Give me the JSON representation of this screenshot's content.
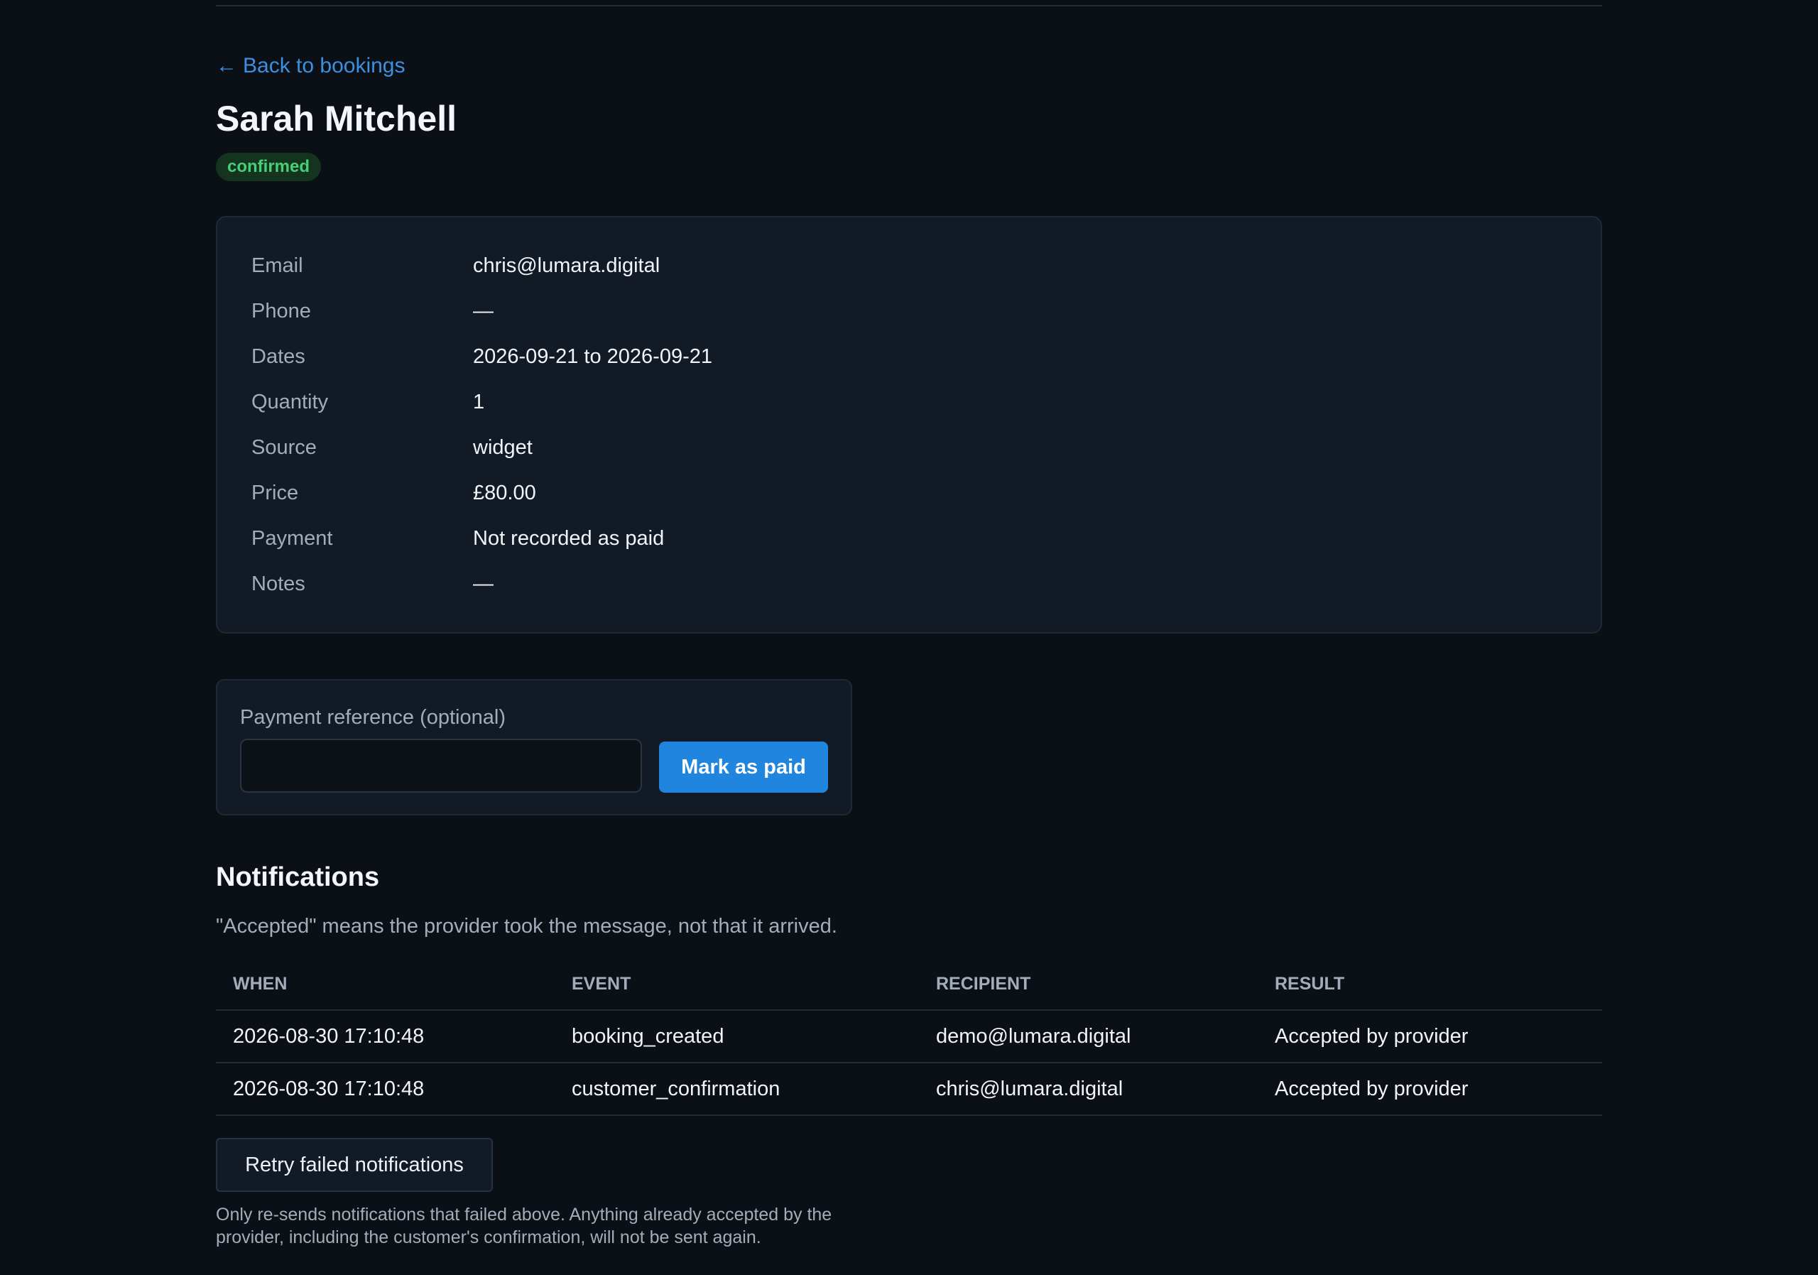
{
  "nav": {
    "back_arrow": "←",
    "back_label": "Back to bookings"
  },
  "booking": {
    "name": "Sarah Mitchell",
    "status": "confirmed",
    "colors": {
      "status_bg": "#15341f",
      "status_fg": "#46cf77",
      "accent": "#2085de"
    },
    "details": [
      {
        "label": "Email",
        "value": "chris@lumara.digital"
      },
      {
        "label": "Phone",
        "value": "—"
      },
      {
        "label": "Dates",
        "value": "2026-09-21 to 2026-09-21"
      },
      {
        "label": "Quantity",
        "value": "1"
      },
      {
        "label": "Source",
        "value": "widget"
      },
      {
        "label": "Price",
        "value": "£80.00"
      },
      {
        "label": "Payment",
        "value": "Not recorded as paid"
      },
      {
        "label": "Notes",
        "value": "—"
      }
    ]
  },
  "payment_form": {
    "label": "Payment reference (optional)",
    "value": "",
    "placeholder": "",
    "button_label": "Mark as paid"
  },
  "notifications": {
    "title": "Notifications",
    "note": "\"Accepted\" means the provider took the message, not that it arrived.",
    "columns": [
      "WHEN",
      "EVENT",
      "RECIPIENT",
      "RESULT"
    ],
    "rows": [
      {
        "when": "2026-08-30 17:10:48",
        "event": "booking_created",
        "recipient": "demo@lumara.digital",
        "result": "Accepted by provider"
      },
      {
        "when": "2026-08-30 17:10:48",
        "event": "customer_confirmation",
        "recipient": "chris@lumara.digital",
        "result": "Accepted by provider"
      }
    ],
    "retry_label": "Retry failed notifications",
    "retry_help": "Only re-sends notifications that failed above. Anything already accepted by the provider, including the customer's confirmation, will not be sent again."
  }
}
